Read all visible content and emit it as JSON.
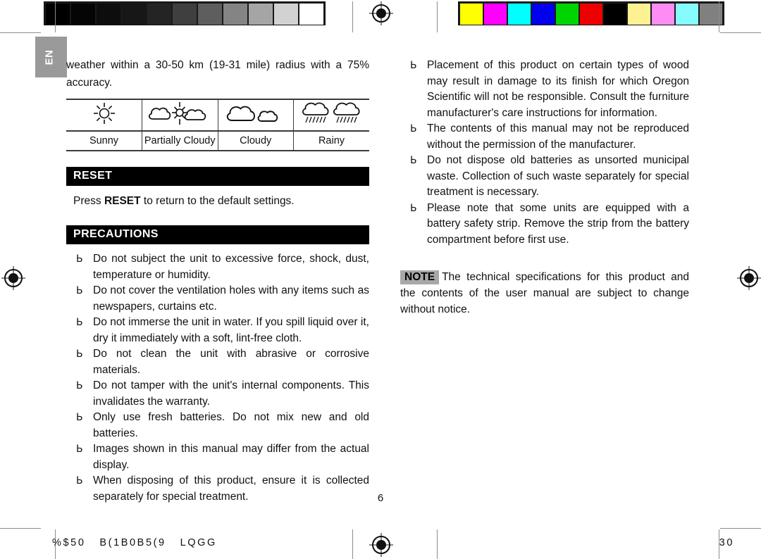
{
  "page": {
    "language_tab": "EN",
    "page_number": "6",
    "footer_left": "%$50   B(1B0B5(9   LQGG",
    "footer_right": "30"
  },
  "calibration": {
    "grayscale_patches": [
      "#000000",
      "#050505",
      "#0d0d0d",
      "#171717",
      "#242424",
      "#3f3f3f",
      "#5e5e5e",
      "#848484",
      "#a5a5a5",
      "#d2d2d2",
      "#ffffff"
    ],
    "color_patches": [
      "#ffff00",
      "#ff00ff",
      "#00ffff",
      "#0000ee",
      "#00d400",
      "#ee0000",
      "#000000",
      "#fdf292",
      "#ff8cf5",
      "#86fcfc",
      "#808080"
    ],
    "registration_mark_name": "registration-target"
  },
  "left_column": {
    "intro_paragraph": "weather within a 30-50 km (19-31 mile) radius with a 75% accuracy.",
    "weather_table": {
      "icons": [
        "sunny-icon",
        "partially-cloudy-icon",
        "cloudy-icon",
        "rainy-icon"
      ],
      "labels": [
        "Sunny",
        "Partially Cloudy",
        "Cloudy",
        "Rainy"
      ]
    },
    "reset_section": {
      "heading": "RESET",
      "text_before": "Press ",
      "text_bold": "RESET",
      "text_after": " to return to the default settings."
    },
    "precautions_section": {
      "heading": "PRECAUTIONS",
      "items": [
        "Do not subject the unit to excessive force, shock, dust, temperature or humidity.",
        "Do not cover the ventilation holes with any items such as newspapers, curtains etc.",
        "Do not immerse the unit in water. If you spill liquid over it, dry it immediately with a soft, lint-free cloth.",
        "Do not clean the unit with abrasive or corrosive materials.",
        "Do not tamper with the unit's internal components. This invalidates the warranty.",
        "Only use fresh batteries. Do not mix new and old batteries.",
        "Images shown in this manual may differ from the actual display.",
        "When disposing of this product, ensure it is collected separately for special treatment."
      ]
    }
  },
  "right_column": {
    "items": [
      "Placement of this product on certain types of wood may result in damage to its finish for which Oregon Scientific will not be responsible. Consult the furniture manufacturer's care instructions for information.",
      "The contents of this manual may not be reproduced without the permission of the manufacturer.",
      "Do not dispose old batteries as unsorted municipal waste. Collection of such waste separately for special treatment is necessary.",
      "Please note that some units are equipped with a battery safety strip. Remove the strip from the battery compartment before first use."
    ],
    "note": {
      "badge": "NOTE",
      "text": "The technical specifications for this product and the contents of the user manual are subject to change without notice."
    }
  },
  "bullet_glyph": "Ь"
}
